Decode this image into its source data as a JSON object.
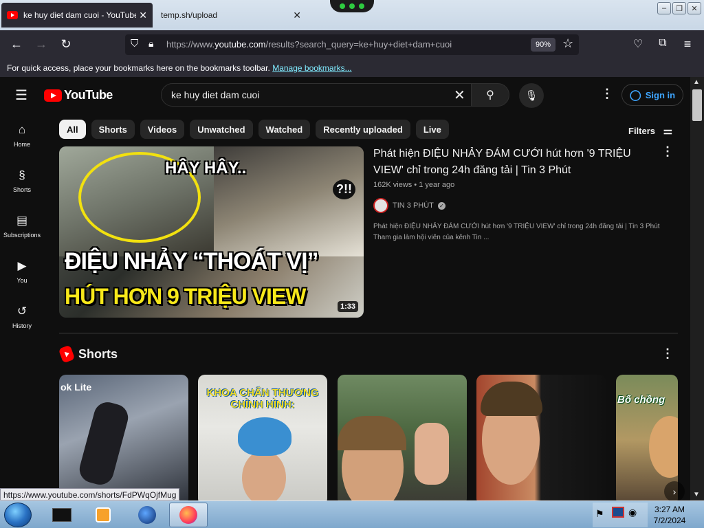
{
  "browser": {
    "tabs": [
      {
        "title": "ke huy diet dam cuoi - YouTube",
        "close": "✕"
      },
      {
        "title": "temp.sh/upload",
        "close": "✕"
      }
    ],
    "url_prefix": "https://www.",
    "url_domain": "youtube.com",
    "url_rest": "/results?search_query=ke+huy+diet+dam+cuoi",
    "zoom": "90%",
    "bookmarks_text": "For quick access, place your bookmarks here on the bookmarks toolbar.",
    "bookmarks_link": "Manage bookmarks..."
  },
  "youtube": {
    "logo_text": "YouTube",
    "search_value": "ke huy diet dam cuoi",
    "signin_label": "Sign in",
    "guide": [
      {
        "label": "Home",
        "icon": "⌂"
      },
      {
        "label": "Shorts",
        "icon": "§"
      },
      {
        "label": "Subscriptions",
        "icon": "▤"
      },
      {
        "label": "You",
        "icon": "▶"
      },
      {
        "label": "History",
        "icon": "↺"
      }
    ],
    "chips": [
      "All",
      "Shorts",
      "Videos",
      "Unwatched",
      "Watched",
      "Recently uploaded",
      "Live"
    ],
    "filters_label": "Filters",
    "video": {
      "title": "Phát hiện ĐIỆU NHẢY ĐÁM CƯỚI hút hơn '9 TRIỆU VIEW' chỉ trong 24h đăng tải | Tin 3 Phút",
      "meta": "162K views • 1 year ago",
      "channel": "TIN 3 PHÚT",
      "description": "Phát hiện ĐIỆU NHẢY ĐÁM CƯỚI hút hơn '9 TRIỆU VIEW' chỉ trong 24h đăng tải | Tin 3 Phút Tham gia làm hội viên của kênh Tin ...",
      "duration": "1:33",
      "thumb_text1": "HÂY HÂY..",
      "thumb_text2": "?!!",
      "thumb_line1": "ĐIỆU NHẢY “THOÁT VỊ”",
      "thumb_line2": "HÚT HƠN 9 TRIỆU VIEW"
    },
    "shorts_heading": "Shorts",
    "shorts": [
      {
        "overlay": "ok Lite"
      },
      {
        "overlay": "KHOA CHẤN THƯƠNG CHỈNH HÌNH:"
      },
      {
        "overlay": ""
      },
      {
        "overlay": ""
      },
      {
        "overlay": "Bố chồng"
      }
    ]
  },
  "status_url": "https://www.youtube.com/shorts/FdPWqOjfMug",
  "taskbar": {
    "time": "3:27 AM",
    "date": "7/2/2024"
  }
}
